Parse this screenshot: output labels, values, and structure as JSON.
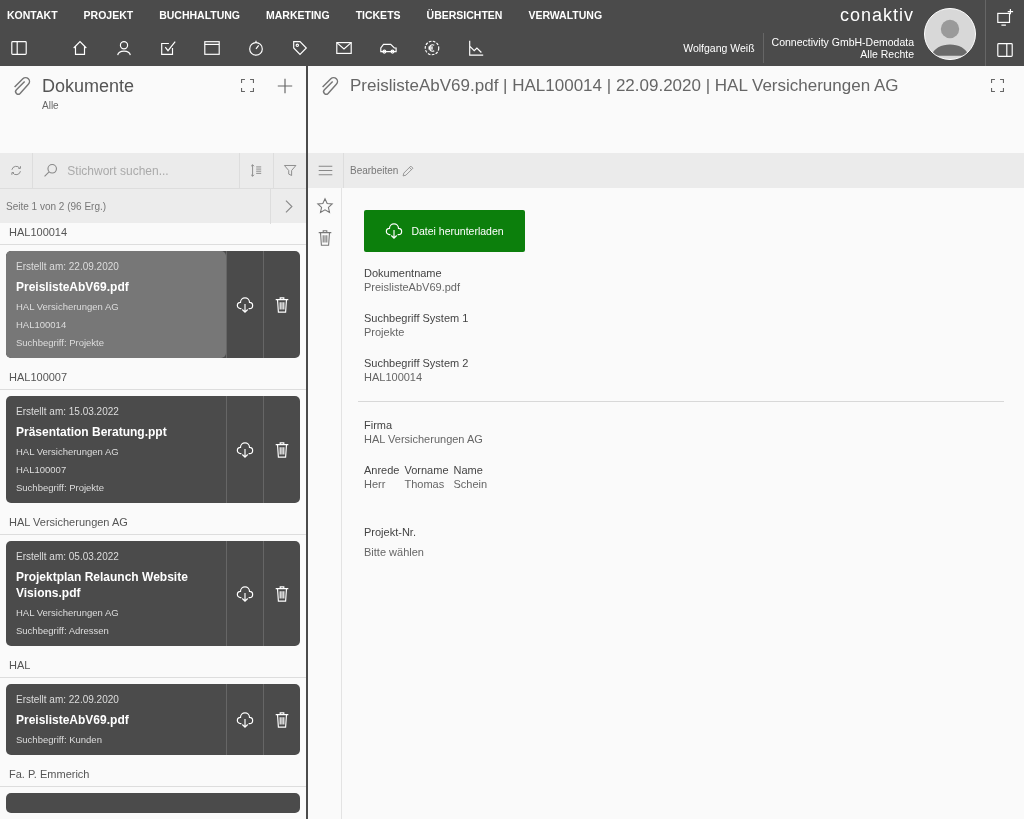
{
  "menu": [
    {
      "label": "KONTAKT"
    },
    {
      "label": "PROJEKT"
    },
    {
      "label": "BUCHHALTUNG"
    },
    {
      "label": "MARKETING"
    },
    {
      "label": "TICKETS"
    },
    {
      "label": "ÜBERSICHTEN"
    },
    {
      "label": "VERWALTUNG"
    }
  ],
  "logo": "conaktiv",
  "user": {
    "name": "Wolfgang Weiß",
    "company": "Connectivity GmbH-Demodata",
    "rights": "Alle Rechte"
  },
  "list_panel": {
    "title": "Dokumente",
    "subtitle": "Alle",
    "search": {
      "placeholder": "Stichwort suchen..."
    },
    "pager": "Seite 1 von 2 (96 Erg.)",
    "groups": [
      {
        "header": "HAL100014",
        "cards": [
          {
            "date": "Erstellt am: 22.09.2020",
            "title": "PreislisteAbV69.pdf",
            "lines": [
              "HAL Versicherungen AG",
              "HAL100014"
            ],
            "term": "Suchbegriff: Projekte",
            "selected": true
          }
        ]
      },
      {
        "header": "HAL100007",
        "cards": [
          {
            "date": "Erstellt am: 15.03.2022",
            "title": "Präsentation Beratung.ppt",
            "lines": [
              "HAL Versicherungen AG",
              "HAL100007"
            ],
            "term": "Suchbegriff: Projekte",
            "selected": false
          }
        ]
      },
      {
        "header": "HAL Versicherungen AG",
        "cards": [
          {
            "date": "Erstellt am: 05.03.2022",
            "title": "Projektplan Relaunch Website Visions.pdf",
            "lines": [
              "HAL Versicherungen AG"
            ],
            "term": "Suchbegriff: Adressen",
            "selected": false
          }
        ]
      },
      {
        "header": "HAL",
        "cards": [
          {
            "date": "Erstellt am: 22.09.2020",
            "title": "PreislisteAbV69.pdf",
            "term": "Suchbegriff: Kunden",
            "selected": false
          }
        ]
      },
      {
        "header": "Fa. P. Emmerich",
        "partial_card": true
      }
    ]
  },
  "detail": {
    "title": "PreislisteAbV69.pdf | HAL100014 | 22.09.2020 | HAL Versicherungen AG",
    "edit": "Bearbeiten",
    "download": "Datei herunterladen",
    "fields": [
      {
        "kind": "field",
        "label": "Dokumentname",
        "value": "PreislisteAbV69.pdf"
      },
      {
        "kind": "field",
        "label": "Suchbegriff System 1",
        "value": "Projekte"
      },
      {
        "kind": "field",
        "label": "Suchbegriff System 2",
        "value": "HAL100014"
      },
      {
        "kind": "divider"
      },
      {
        "kind": "field",
        "label": "Firma",
        "value": "HAL Versicherungen AG"
      },
      {
        "kind": "columns",
        "columns": [
          {
            "label": "Anrede",
            "value": "Herr"
          },
          {
            "label": "Vorname",
            "value": "Thomas"
          },
          {
            "label": "Name",
            "value": "Schein"
          }
        ]
      },
      {
        "kind": "select",
        "label": "Projekt-Nr.",
        "placeholder": "Bitte wählen"
      }
    ]
  }
}
